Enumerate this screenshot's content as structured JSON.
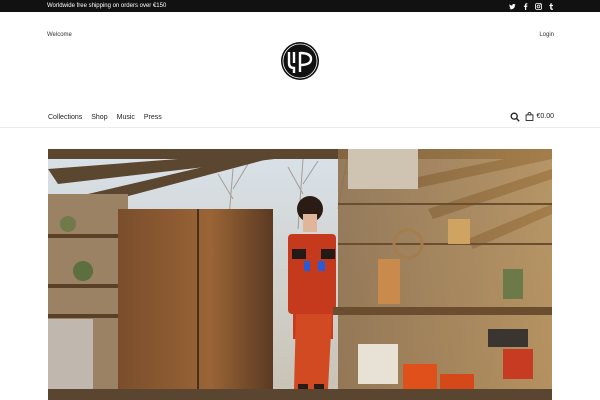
{
  "topbar": {
    "promo": "Worldwide free shipping on orders over €150",
    "social": [
      "twitter-icon",
      "facebook-icon",
      "instagram-icon",
      "tumblr-icon"
    ]
  },
  "header": {
    "welcome": "Welcome",
    "login": "Login",
    "logo_icon": "brand-logo-circle"
  },
  "nav": {
    "items": [
      "Collections",
      "Shop",
      "Music",
      "Press"
    ]
  },
  "cart": {
    "total": "€0.00"
  },
  "colors": {
    "topbar_bg": "#111111",
    "text": "#222222",
    "divider": "#ececec"
  },
  "hero": {
    "description_icon": "hero-photo"
  }
}
